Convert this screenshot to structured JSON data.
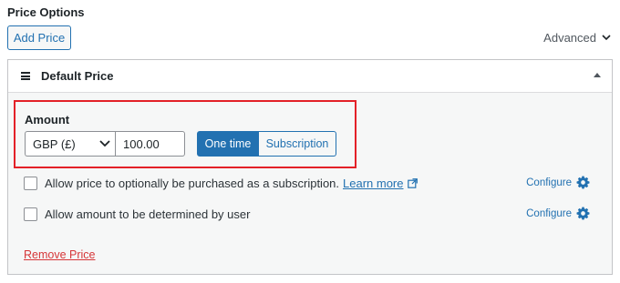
{
  "section": {
    "title": "Price Options"
  },
  "toolbar": {
    "add_price_label": "Add Price",
    "advanced_label": "Advanced"
  },
  "price": {
    "title": "Default Price",
    "amount_label": "Amount",
    "currency": "GBP (£)",
    "amount_value": "100.00",
    "modes": [
      "One time",
      "Subscription"
    ],
    "active_mode": "One time",
    "options": [
      {
        "label": "Allow price to optionally be purchased as a subscription.",
        "link": "Learn more",
        "configure": "Configure",
        "checked": false
      },
      {
        "label": "Allow amount to be determined by user",
        "configure": "Configure",
        "checked": false
      }
    ],
    "remove_label": "Remove Price"
  },
  "colors": {
    "accent": "#2271b1",
    "highlight": "#e32128",
    "danger": "#d63638"
  },
  "icons": [
    "chevron-down-icon",
    "drag-handle-icon",
    "collapse-arrow-icon",
    "external-link-icon",
    "gear-icon"
  ]
}
